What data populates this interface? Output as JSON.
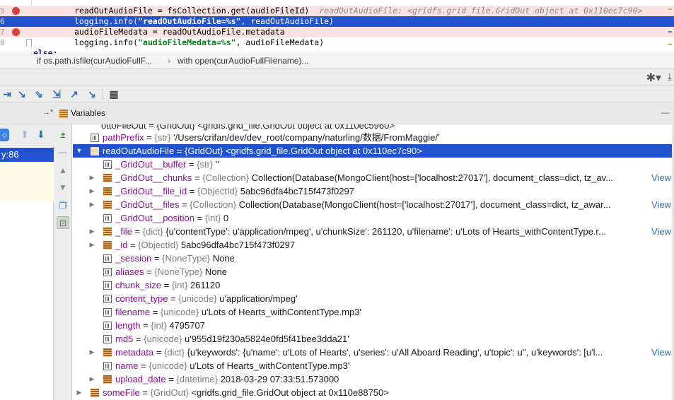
{
  "editor": {
    "lines": [
      {
        "num": "5",
        "breakpoint": true,
        "text": "readOutAudioFile = fsCollection.get(audioFileId)",
        "hint": "readOutAudioFile: <gridfs.grid_file.GridOut object at 0x110ec7c90>"
      },
      {
        "num": "6",
        "breakpoint": false,
        "current": true,
        "prefix": "logging.info(",
        "string": "\"readOutAudioFile=%s\"",
        "suffix": ", readOutAudioFile)"
      },
      {
        "num": "7",
        "breakpoint": true,
        "text": "audioFileMedata = readOutAudioFile.metadata"
      },
      {
        "num": "8",
        "breakpoint": false,
        "prefix": "logging.info(",
        "string": "\"audioFileMedata=%s\"",
        "suffix": ", audioFileMedata)"
      }
    ],
    "else_keyword": "else:"
  },
  "breadcrumb": {
    "items": [
      "if os.path.isfile(curAudioFullF...",
      "with open(curAudioFullFilename)..."
    ],
    "separator": "›"
  },
  "debug_header": {
    "settings_icon": "gear-icon",
    "settings_glyph": "✱▾",
    "hide_glyph": "⤓"
  },
  "step_toolbar": {
    "buttons": [
      {
        "name": "show-execution-point",
        "glyph": "⇥"
      },
      {
        "name": "step-over",
        "glyph": "↘"
      },
      {
        "name": "step-into",
        "glyph": "⇘"
      },
      {
        "name": "step-into-my-code",
        "glyph": "⇲"
      },
      {
        "name": "step-out",
        "glyph": "↗"
      },
      {
        "name": "run-to-cursor",
        "glyph": "↘"
      },
      {
        "name": "evaluate-expression",
        "glyph": "▦"
      }
    ]
  },
  "variables_panel": {
    "title": "Variables",
    "pin_glyph": "→*",
    "collapse_glyph": "—"
  },
  "frames": {
    "selected_frame": "y:86"
  },
  "tree": {
    "clipped_top": "ottoFileOut = {GridOut} <gridfs.grid_file.GridOut object at 0x110ec5960>",
    "rows": [
      {
        "indent": 0,
        "toggle": "",
        "icon": "prim",
        "name": "pathPrefix",
        "type": "{str}",
        "value": "'/Users/crifan/dev/dev_root/company/naturling/数据/FromMaggie/'",
        "view": ""
      },
      {
        "indent": 0,
        "toggle": "▼",
        "icon": "obj",
        "name": "readOutAudioFile",
        "type": "{GridOut}",
        "value": "<gridfs.grid_file.GridOut object at 0x110ec7c90>",
        "view": "",
        "selected": true
      },
      {
        "indent": 1,
        "toggle": "",
        "icon": "prim",
        "name": "_GridOut__buffer",
        "type": "{str}",
        "value": "''",
        "view": ""
      },
      {
        "indent": 1,
        "toggle": "▶",
        "icon": "obj",
        "name": "_GridOut__chunks",
        "type": "{Collection}",
        "value": "Collection(Database(MongoClient(host=['localhost:27017'], document_class=dict, tz_av...",
        "view": "View"
      },
      {
        "indent": 1,
        "toggle": "▶",
        "icon": "obj",
        "name": "_GridOut__file_id",
        "type": "{ObjectId}",
        "value": "5abc96dfa4bc715f473f0297",
        "view": ""
      },
      {
        "indent": 1,
        "toggle": "▶",
        "icon": "obj",
        "name": "_GridOut__files",
        "type": "{Collection}",
        "value": "Collection(Database(MongoClient(host=['localhost:27017'], document_class=dict, tz_awar...",
        "view": "View"
      },
      {
        "indent": 1,
        "toggle": "",
        "icon": "prim",
        "name": "_GridOut__position",
        "type": "{int}",
        "value": "0",
        "view": ""
      },
      {
        "indent": 1,
        "toggle": "▶",
        "icon": "obj",
        "name": "_file",
        "type": "{dict}",
        "value": "{u'contentType': u'application/mpeg', u'chunkSize': 261120, u'filename': u'Lots of Hearts_withContentType.r...",
        "view": "View"
      },
      {
        "indent": 1,
        "toggle": "▶",
        "icon": "obj",
        "name": "_id",
        "type": "{ObjectId}",
        "value": "5abc96dfa4bc715f473f0297",
        "view": ""
      },
      {
        "indent": 1,
        "toggle": "",
        "icon": "prim",
        "name": "_session",
        "type": "{NoneType}",
        "value": "None",
        "view": ""
      },
      {
        "indent": 1,
        "toggle": "",
        "icon": "prim",
        "name": "aliases",
        "type": "{NoneType}",
        "value": "None",
        "view": ""
      },
      {
        "indent": 1,
        "toggle": "",
        "icon": "prim",
        "name": "chunk_size",
        "type": "{int}",
        "value": "261120",
        "view": ""
      },
      {
        "indent": 1,
        "toggle": "",
        "icon": "prim",
        "name": "content_type",
        "type": "{unicode}",
        "value": "u'application/mpeg'",
        "view": ""
      },
      {
        "indent": 1,
        "toggle": "",
        "icon": "prim",
        "name": "filename",
        "type": "{unicode}",
        "value": "u'Lots of Hearts_withContentType.mp3'",
        "view": ""
      },
      {
        "indent": 1,
        "toggle": "",
        "icon": "prim",
        "name": "length",
        "type": "{int}",
        "value": "4795707",
        "view": ""
      },
      {
        "indent": 1,
        "toggle": "",
        "icon": "prim",
        "name": "md5",
        "type": "{unicode}",
        "value": "u'955d19f230a5824e0fd5f41bee3dda21'",
        "view": ""
      },
      {
        "indent": 1,
        "toggle": "▶",
        "icon": "obj",
        "name": "metadata",
        "type": "{dict}",
        "value": "{u'keywords': {u'name': u'Lots of Hearts', u'series': u'All Aboard Reading', u'topic': u'', u'keywords': [u'l...",
        "view": "View"
      },
      {
        "indent": 1,
        "toggle": "",
        "icon": "prim",
        "name": "name",
        "type": "{unicode}",
        "value": "u'Lots of Hearts_withContentType.mp3'",
        "view": ""
      },
      {
        "indent": 1,
        "toggle": "▶",
        "icon": "obj",
        "name": "upload_date",
        "type": "{datetime}",
        "value": "2018-03-29 07:33:51.573000",
        "view": ""
      },
      {
        "indent": 0,
        "toggle": "▶",
        "icon": "obj",
        "name": "someFile",
        "type": "{GridOut}",
        "value": "<gridfs.grid_file.GridOut object at 0x110e88750>",
        "view": ""
      }
    ]
  },
  "colors": {
    "selection": "#2153d1",
    "breakpoint": "#d9423a",
    "breakpoint_line": "#f9e3e1",
    "var_name": "#871094",
    "type_hint": "#7d7d7d",
    "view_link": "#2a6ec4"
  }
}
